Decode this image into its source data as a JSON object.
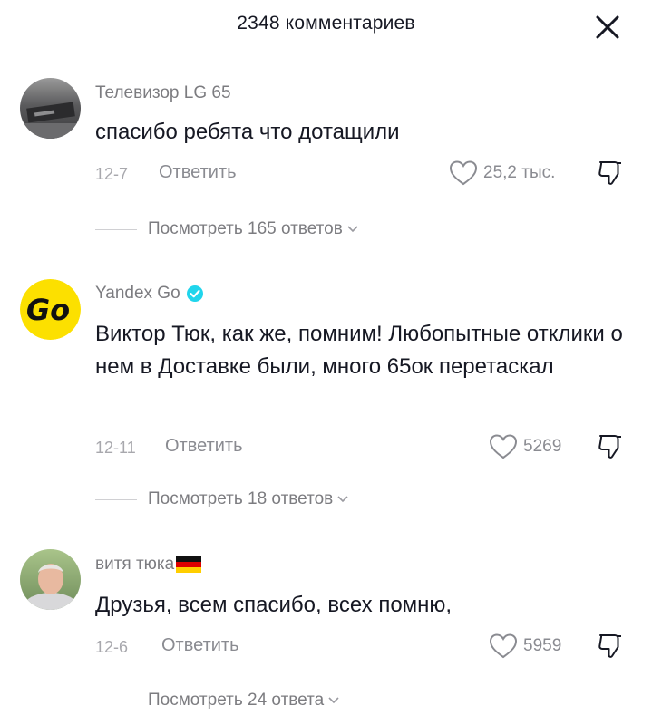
{
  "header": {
    "title": "2348 комментариев"
  },
  "comments": [
    {
      "author": "Телевизор LG 65",
      "text": "спасибо ребята что дотащили",
      "date": "12-7",
      "reply_label": "Ответить",
      "likes": "25,2 тыс.",
      "view_replies": "Посмотреть 165 ответов"
    },
    {
      "author": "Yandex Go",
      "verified": true,
      "avatar_text": "Go",
      "text": "Виктор Тюк, как же, помним! Любопытные отклики о нем в Доставке были, много 65ок перетаскал",
      "date": "12-11",
      "reply_label": "Ответить",
      "likes": "5269",
      "view_replies": "Посмотреть 18 ответов"
    },
    {
      "author": "витя тюка",
      "text": "Друзья, всем спасибо, всех помню,",
      "date": "12-6",
      "reply_label": "Ответить",
      "likes": "5959",
      "view_replies": "Посмотреть 24 ответа"
    }
  ],
  "colors": {
    "yandex_yellow": "#fce000",
    "verified_blue": "#20d5ec",
    "muted": "#8a8b91"
  },
  "icons": [
    "close-icon",
    "heart-icon",
    "dislike-icon",
    "chevron-down-icon",
    "verified-badge-icon",
    "german-flag-icon"
  ]
}
